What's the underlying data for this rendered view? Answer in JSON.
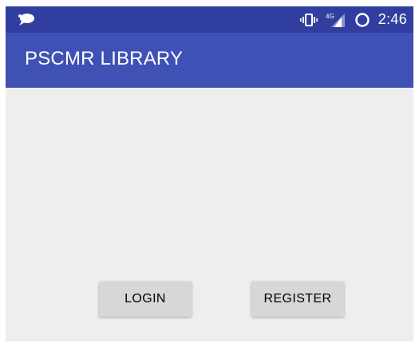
{
  "status_bar": {
    "time": "2:46",
    "network_label": "4G",
    "icons": [
      "chat-notification-icon",
      "vibrate-icon",
      "signal-4g-icon",
      "sync-icon"
    ],
    "background_color": "#303f9f"
  },
  "app_bar": {
    "title": "PSCMR LIBRARY",
    "background_color": "#3f51b5"
  },
  "actions": {
    "login_label": "LOGIN",
    "register_label": "REGISTER"
  },
  "colors": {
    "content_background": "#eeeeee",
    "button_background": "#d6d7d7"
  }
}
